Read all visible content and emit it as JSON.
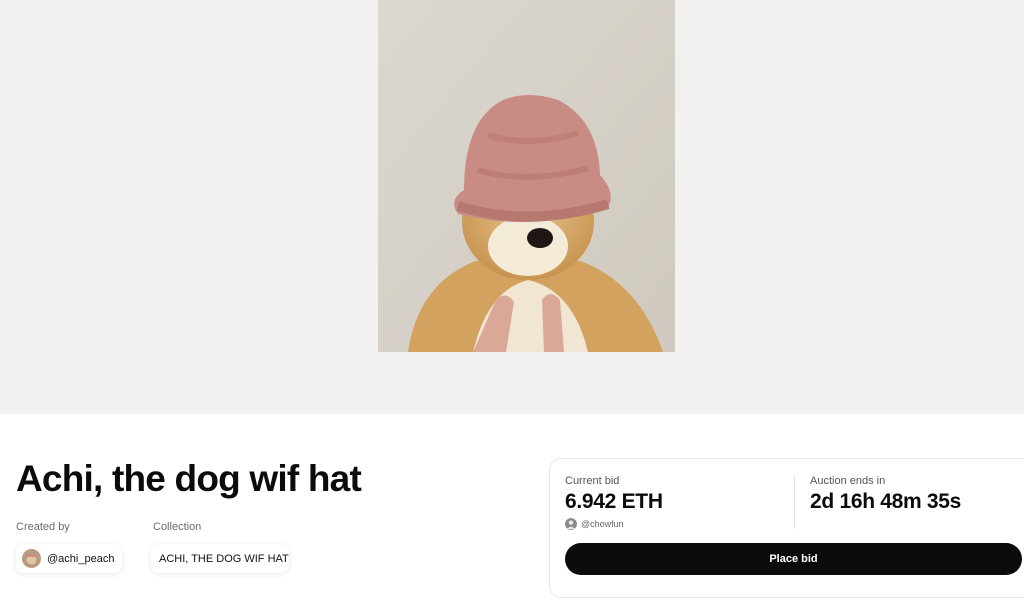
{
  "nft": {
    "title": "Achi, the dog wif hat",
    "artwork_alt": "Shiba Inu puppy wearing a pink knitted hat",
    "created_by_label": "Created by",
    "creator_handle": "@achi_peach",
    "collection_label": "Collection",
    "collection_name": "ACHI, THE DOG WIF HAT"
  },
  "auction": {
    "current_bid_label": "Current bid",
    "current_bid_value": "6.942 ETH",
    "bidder_handle": "@chowfun",
    "ends_in_label": "Auction ends in",
    "ends_in_value": "2d 16h 48m 35s",
    "place_bid_label": "Place bid"
  },
  "colors": {
    "hero_background": "#f2f1f0",
    "button_background": "#0b0b0b",
    "button_text": "#ffffff",
    "hat_pink": "#c98c84"
  },
  "icons": {
    "creator_avatar": "dog-avatar-icon",
    "bidder_avatar": "user-avatar-icon"
  }
}
